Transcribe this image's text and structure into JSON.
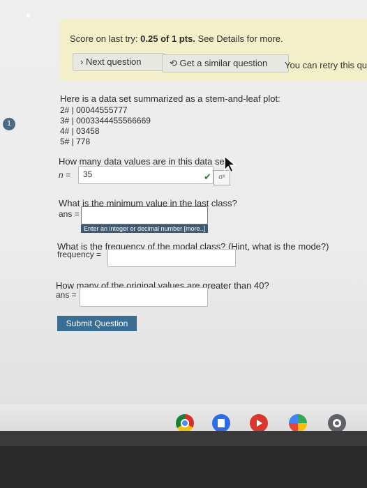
{
  "banner": {
    "score_prefix": "Score on last try: ",
    "score_value": "0.25 of 1 pts.",
    "score_suffix": " See Details for more.",
    "next_label": "Next question",
    "similar_label": "Get a similar question",
    "retry_text": "You can retry this qu"
  },
  "question_number": "1",
  "intro": "Here is a data set summarized as a stem-and-leaf plot:",
  "stem_leaf": [
    "2# | 00044555777",
    "3# | 0003344455566669",
    "4# | 03458",
    "5# | 778"
  ],
  "q1": {
    "text": "How many data values are in this data se",
    "label": "n =",
    "value": "35"
  },
  "q2": {
    "text": "What is the minimum value in the last class?",
    "label": "ans =",
    "value": "",
    "hint": "Enter an integer or decimal number [more..]"
  },
  "q3": {
    "text": "What is the frequency of the modal class? (Hint, what is the mode?)",
    "label": "frequency =",
    "value": ""
  },
  "q4": {
    "text": "How many of the original values are greater than 40?",
    "label": "ans =",
    "value": ""
  },
  "submit_label": "Submit Question",
  "colors": {
    "submit": "#3a6d93",
    "banner": "#f3f0c9",
    "check": "#2c7a2c"
  },
  "icons": [
    "chrome-icon",
    "docs-icon",
    "youtube-icon",
    "play-store-icon",
    "settings-icon"
  ]
}
